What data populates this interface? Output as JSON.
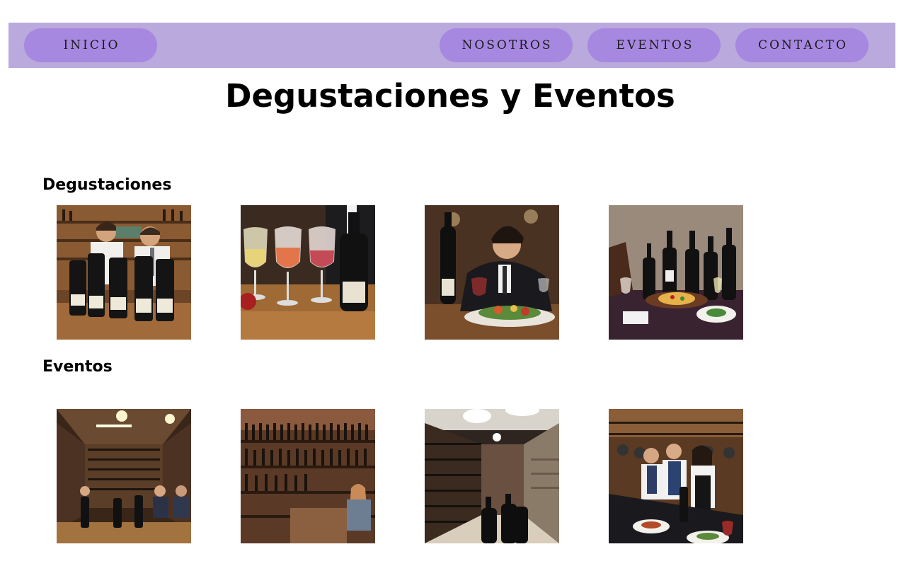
{
  "nav": {
    "inicio": "INICIO",
    "nosotros": "NOSOTROS",
    "eventos": "EVENTOS",
    "contacto": "CONTACTO"
  },
  "page": {
    "title": "Degustaciones y Eventos"
  },
  "sections": {
    "degustaciones": {
      "title": "Degustaciones",
      "images": [
        {
          "icon": "sommeliers-with-wine-bottles-photo"
        },
        {
          "icon": "three-wine-glasses-photo"
        },
        {
          "icon": "man-with-wine-and-salad-photo"
        },
        {
          "icon": "wine-bottles-and-pizza-table-photo"
        }
      ]
    },
    "eventos": {
      "title": "Eventos",
      "images": [
        {
          "icon": "wine-cellar-tasting-room-photo"
        },
        {
          "icon": "wine-shelves-shop-photo"
        },
        {
          "icon": "wine-cellar-corridor-photo"
        },
        {
          "icon": "crowded-wine-dinner-photo"
        }
      ]
    }
  },
  "colors": {
    "nav_bar": "#b9a9dc",
    "nav_pill": "#a788e0"
  }
}
